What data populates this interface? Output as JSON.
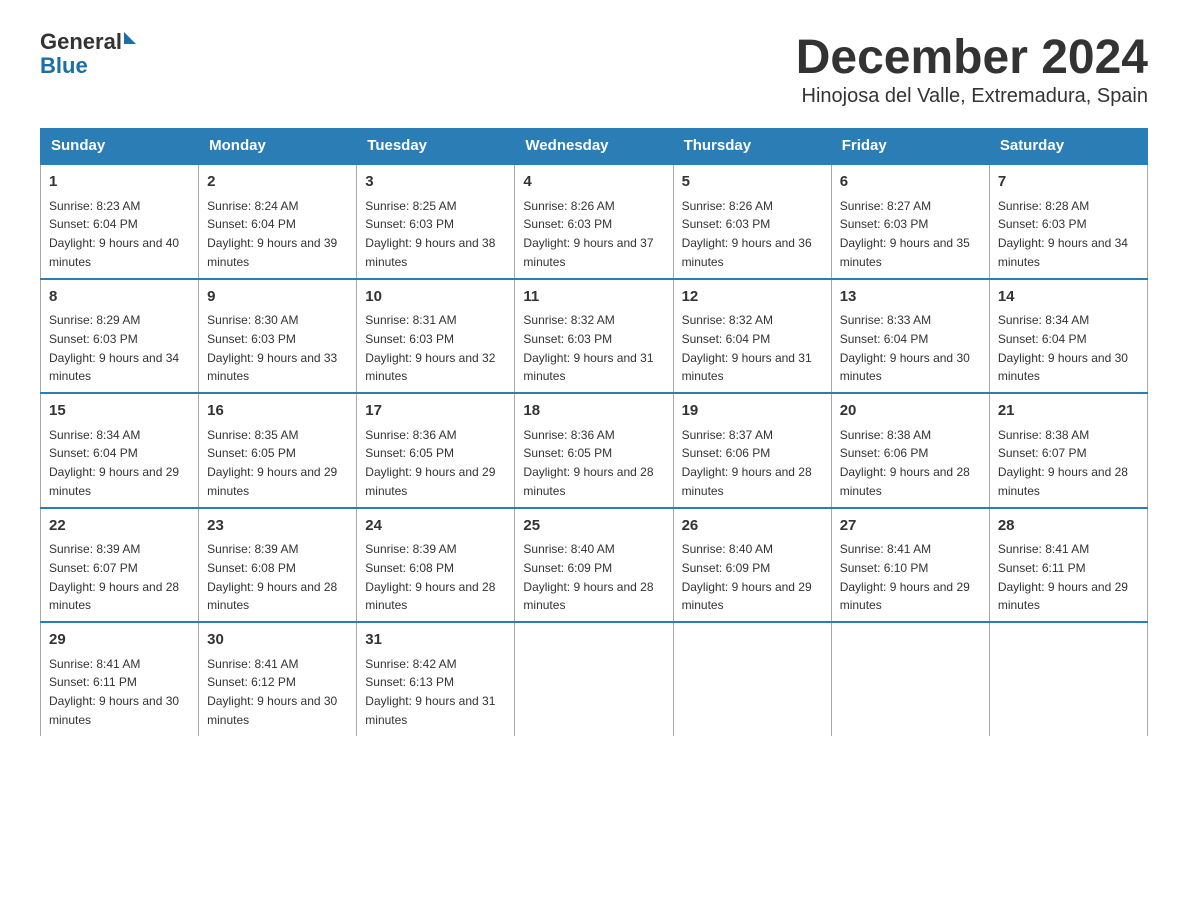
{
  "header": {
    "logo": {
      "general": "General",
      "blue": "Blue"
    },
    "title": "December 2024",
    "location": "Hinojosa del Valle, Extremadura, Spain"
  },
  "days_of_week": [
    "Sunday",
    "Monday",
    "Tuesday",
    "Wednesday",
    "Thursday",
    "Friday",
    "Saturday"
  ],
  "weeks": [
    [
      {
        "day": "1",
        "sunrise": "8:23 AM",
        "sunset": "6:04 PM",
        "daylight": "9 hours and 40 minutes."
      },
      {
        "day": "2",
        "sunrise": "8:24 AM",
        "sunset": "6:04 PM",
        "daylight": "9 hours and 39 minutes."
      },
      {
        "day": "3",
        "sunrise": "8:25 AM",
        "sunset": "6:03 PM",
        "daylight": "9 hours and 38 minutes."
      },
      {
        "day": "4",
        "sunrise": "8:26 AM",
        "sunset": "6:03 PM",
        "daylight": "9 hours and 37 minutes."
      },
      {
        "day": "5",
        "sunrise": "8:26 AM",
        "sunset": "6:03 PM",
        "daylight": "9 hours and 36 minutes."
      },
      {
        "day": "6",
        "sunrise": "8:27 AM",
        "sunset": "6:03 PM",
        "daylight": "9 hours and 35 minutes."
      },
      {
        "day": "7",
        "sunrise": "8:28 AM",
        "sunset": "6:03 PM",
        "daylight": "9 hours and 34 minutes."
      }
    ],
    [
      {
        "day": "8",
        "sunrise": "8:29 AM",
        "sunset": "6:03 PM",
        "daylight": "9 hours and 34 minutes."
      },
      {
        "day": "9",
        "sunrise": "8:30 AM",
        "sunset": "6:03 PM",
        "daylight": "9 hours and 33 minutes."
      },
      {
        "day": "10",
        "sunrise": "8:31 AM",
        "sunset": "6:03 PM",
        "daylight": "9 hours and 32 minutes."
      },
      {
        "day": "11",
        "sunrise": "8:32 AM",
        "sunset": "6:03 PM",
        "daylight": "9 hours and 31 minutes."
      },
      {
        "day": "12",
        "sunrise": "8:32 AM",
        "sunset": "6:04 PM",
        "daylight": "9 hours and 31 minutes."
      },
      {
        "day": "13",
        "sunrise": "8:33 AM",
        "sunset": "6:04 PM",
        "daylight": "9 hours and 30 minutes."
      },
      {
        "day": "14",
        "sunrise": "8:34 AM",
        "sunset": "6:04 PM",
        "daylight": "9 hours and 30 minutes."
      }
    ],
    [
      {
        "day": "15",
        "sunrise": "8:34 AM",
        "sunset": "6:04 PM",
        "daylight": "9 hours and 29 minutes."
      },
      {
        "day": "16",
        "sunrise": "8:35 AM",
        "sunset": "6:05 PM",
        "daylight": "9 hours and 29 minutes."
      },
      {
        "day": "17",
        "sunrise": "8:36 AM",
        "sunset": "6:05 PM",
        "daylight": "9 hours and 29 minutes."
      },
      {
        "day": "18",
        "sunrise": "8:36 AM",
        "sunset": "6:05 PM",
        "daylight": "9 hours and 28 minutes."
      },
      {
        "day": "19",
        "sunrise": "8:37 AM",
        "sunset": "6:06 PM",
        "daylight": "9 hours and 28 minutes."
      },
      {
        "day": "20",
        "sunrise": "8:38 AM",
        "sunset": "6:06 PM",
        "daylight": "9 hours and 28 minutes."
      },
      {
        "day": "21",
        "sunrise": "8:38 AM",
        "sunset": "6:07 PM",
        "daylight": "9 hours and 28 minutes."
      }
    ],
    [
      {
        "day": "22",
        "sunrise": "8:39 AM",
        "sunset": "6:07 PM",
        "daylight": "9 hours and 28 minutes."
      },
      {
        "day": "23",
        "sunrise": "8:39 AM",
        "sunset": "6:08 PM",
        "daylight": "9 hours and 28 minutes."
      },
      {
        "day": "24",
        "sunrise": "8:39 AM",
        "sunset": "6:08 PM",
        "daylight": "9 hours and 28 minutes."
      },
      {
        "day": "25",
        "sunrise": "8:40 AM",
        "sunset": "6:09 PM",
        "daylight": "9 hours and 28 minutes."
      },
      {
        "day": "26",
        "sunrise": "8:40 AM",
        "sunset": "6:09 PM",
        "daylight": "9 hours and 29 minutes."
      },
      {
        "day": "27",
        "sunrise": "8:41 AM",
        "sunset": "6:10 PM",
        "daylight": "9 hours and 29 minutes."
      },
      {
        "day": "28",
        "sunrise": "8:41 AM",
        "sunset": "6:11 PM",
        "daylight": "9 hours and 29 minutes."
      }
    ],
    [
      {
        "day": "29",
        "sunrise": "8:41 AM",
        "sunset": "6:11 PM",
        "daylight": "9 hours and 30 minutes."
      },
      {
        "day": "30",
        "sunrise": "8:41 AM",
        "sunset": "6:12 PM",
        "daylight": "9 hours and 30 minutes."
      },
      {
        "day": "31",
        "sunrise": "8:42 AM",
        "sunset": "6:13 PM",
        "daylight": "9 hours and 31 minutes."
      },
      null,
      null,
      null,
      null
    ]
  ]
}
